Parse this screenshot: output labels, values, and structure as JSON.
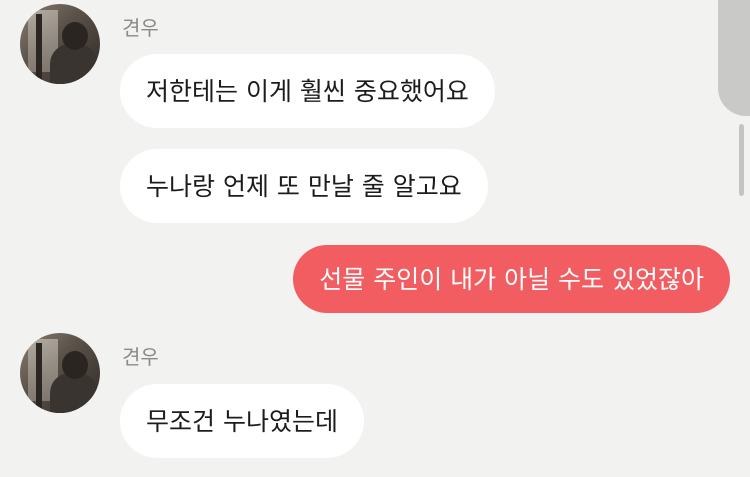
{
  "messages": [
    {
      "sender": "견우",
      "text": "저한테는 이게 훨씬 중요했어요"
    },
    {
      "text": "누나랑 언제 또 만날 줄 알고요"
    },
    {
      "text": "선물 주인이 내가 아닐 수도 있었잖아"
    },
    {
      "sender": "견우",
      "text": "무조건 누나였는데"
    }
  ],
  "colors": {
    "background": "#f2f2f0",
    "incoming_bubble": "#ffffff",
    "outgoing_bubble": "#f25d61"
  }
}
